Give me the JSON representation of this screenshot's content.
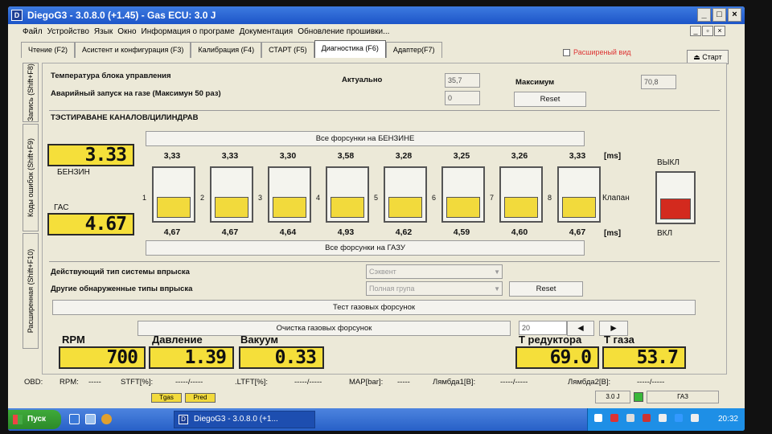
{
  "window": {
    "title": "DiegoG3 - 3.0.8.0 (+1.45) - Gas ECU: 3.0 J",
    "app_icon": "D"
  },
  "menu": [
    "Файл",
    "Устройство",
    "Язык",
    "Окно",
    "Информация о програме",
    "Документация",
    "Обновление прошивки..."
  ],
  "tabs": [
    {
      "label": "Чтение (F2)",
      "active": false
    },
    {
      "label": "Асистент и конфигурация (F3)",
      "active": false
    },
    {
      "label": "Калибрация (F4)",
      "active": false
    },
    {
      "label": "СТАРТ (F5)",
      "active": false
    },
    {
      "label": "Диагностика (F6)",
      "active": true
    },
    {
      "label": "Адаптер(F7)",
      "active": false
    }
  ],
  "extended_view_label": "Расширеный вид",
  "start_button": "Старт",
  "side_tabs": [
    "Запись (Shift+F8)",
    "Коды ошибок (Shift+F9)",
    "Расширенная (Shift+F10)"
  ],
  "ecu": {
    "temp_label": "Температура блока управления",
    "emergency_label": "Аварийный запуск на газе (Максимун 50 раз)",
    "actual_label": "Актуально",
    "actual_value": "35,7",
    "emergency_value": "0",
    "max_label": "Максимум",
    "max_value": "70,8",
    "reset_label": "Reset"
  },
  "test_section": {
    "title": "ТЭСТИРАВАНЕ КАНАЛОВ/ЦИЛИНДРАВ",
    "all_petrol_button": "Все форсунки на БЕНЗИНЕ",
    "all_gas_button": "Все форсунки на ГАЗУ",
    "petrol_display": "3.33",
    "petrol_label": "БЕНЗИН",
    "gas_label": "ГАС",
    "gas_display": "4.67",
    "cylinders": [
      {
        "num": "1",
        "petrol": "3,33",
        "gas": "4,67"
      },
      {
        "num": "2",
        "petrol": "3,33",
        "gas": "4,67"
      },
      {
        "num": "3",
        "petrol": "3,30",
        "gas": "4,64"
      },
      {
        "num": "4",
        "petrol": "3,58",
        "gas": "4,93"
      },
      {
        "num": "5",
        "petrol": "3,28",
        "gas": "4,62"
      },
      {
        "num": "6",
        "petrol": "3,25",
        "gas": "4,59"
      },
      {
        "num": "7",
        "petrol": "3,26",
        "gas": "4,60"
      },
      {
        "num": "8",
        "petrol": "3,33",
        "gas": "4,67"
      }
    ],
    "unit_ms": "[ms]",
    "valve_label": "Клапан",
    "valve_off": "ВЫКЛ",
    "valve_on": "ВКЛ",
    "valve_color": "#d32a1e"
  },
  "injection": {
    "active_type_label": "Действующий тип системы впрыска",
    "active_type_value": "Сэквент",
    "other_types_label": "Другие обнаруженные типы впрыска",
    "other_types_value": "Полная група",
    "reset_label": "Reset"
  },
  "gas_test_button": "Тест газовых форсунок",
  "clean_button": "Очистка газовых форсунок",
  "clean_value": "20",
  "gauges": {
    "rpm": {
      "label": "RPM",
      "value": "700"
    },
    "pressure": {
      "label": "Давление",
      "value": "1.39"
    },
    "vacuum": {
      "label": "Вакуум",
      "value": "0.33"
    },
    "t_reducer": {
      "label": "T редуктора",
      "value": "69.0"
    },
    "t_gas": {
      "label": "T газа",
      "value": "53.7"
    }
  },
  "status": {
    "obd": "OBD:",
    "rpm": "RPM:",
    "rpm_val": "-----",
    "stft": "STFT[%]:",
    "stft_val": "-----/-----",
    "ltft": ".LTFT[%]:",
    "ltft_val": "-----/-----",
    "map": "MAP[bar]:",
    "map_val": "-----",
    "lambda1": "Лямбда1[В]:",
    "lambda1_val": "-----/-----",
    "lambda2": "Лямбда2[В]:",
    "lambda2_val": "-----/-----",
    "tgas_tag": "Tgas",
    "pred_tag": "Pred",
    "version": "3.0 J",
    "mode": "ГАЗ"
  },
  "taskbar": {
    "start": "Пуск",
    "task": "DiegoG3 - 3.0.8.0 (+1...",
    "time": "20:32"
  }
}
